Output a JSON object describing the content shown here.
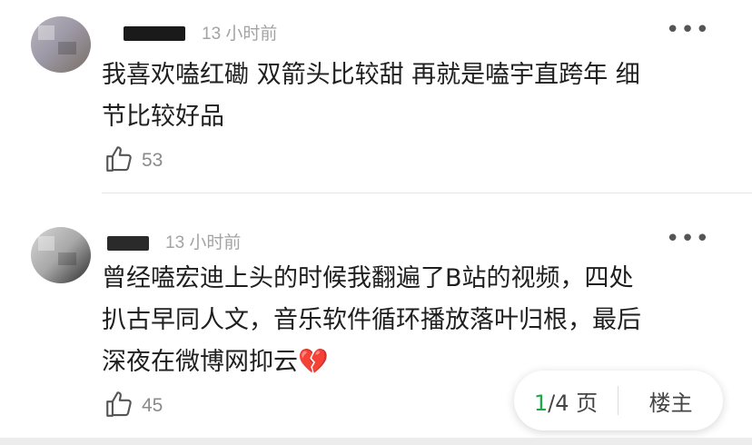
{
  "comments": [
    {
      "time": "13 小时前",
      "more_label": "•••",
      "text_lines": [
        "我喜欢嗑红磡 双箭头比较甜 再就是嗑宇直跨年 细",
        "节比较好品"
      ],
      "likes": "53"
    },
    {
      "time": "13 小时前",
      "more_label": "•••",
      "text_lines": [
        "曾经嗑宏迪上头的时候我翻遍了B站的视频，四处",
        "扒古早同人文，音乐软件循环播放落叶归根，最后",
        "深夜在微博网抑云💔"
      ],
      "likes": "45"
    }
  ],
  "pager": {
    "current": "1",
    "total_text": "/4 页",
    "op_label": "楼主"
  },
  "colors": {
    "accent": "#1ea84a",
    "muted": "#a3a3a3"
  },
  "icons": {
    "like": "thumbs-up-icon",
    "more": "more-icon"
  }
}
